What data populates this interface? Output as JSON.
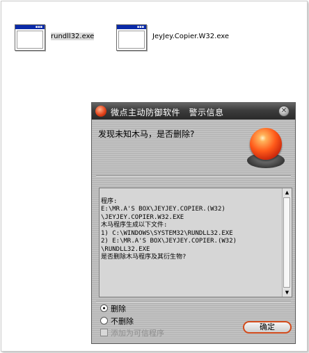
{
  "desktop": {
    "icons": [
      {
        "label": "rundll32.exe",
        "selected": true
      },
      {
        "label": "JeyJey.Copier.W32.exe",
        "selected": false
      }
    ]
  },
  "dialog": {
    "title": "微点主动防御软件　警示信息",
    "question": "发现未知木马，是否删除?",
    "message_lines": [
      "程序:",
      "E:\\MR.A'S BOX\\JEYJEY.COPIER.(W32)",
      "\\JEYJEY.COPIER.W32.EXE",
      "木马程序生成以下文件:",
      "1) C:\\WINDOWS\\SYSTEM32\\RUNDLL32.EXE",
      "2) E:\\MR.A'S BOX\\JEYJEY.COPIER.(W32)",
      "\\RUNDLL32.EXE",
      "是否删除木马程序及其衍生物?"
    ],
    "options": {
      "delete_label": "删除",
      "keep_label": "不删除",
      "trust_label": "添加为可信程序",
      "selected": "delete"
    },
    "ok_label": "确定",
    "icons": {
      "logo": "app-logo-icon",
      "close": "close-icon",
      "alarm": "alarm-light-icon"
    },
    "colors": {
      "titlebar": "#3c3c3c",
      "ok_border": "#d24a1a",
      "alarm": "#ff5a1a"
    }
  }
}
